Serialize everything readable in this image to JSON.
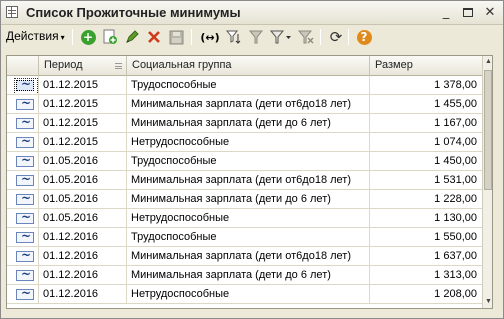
{
  "window": {
    "title": "Список Прожиточные минимумы",
    "btn_min": "_",
    "btn_close": "✕"
  },
  "toolbar": {
    "actions_label": "Действия",
    "actions_caret": "▾",
    "icons": [
      "add-icon",
      "copy-icon",
      "edit-icon",
      "delete-icon",
      "save-icon",
      "move-icon",
      "filter-icon",
      "filter-set-icon",
      "filter-dropdown-icon",
      "filter-clear-icon",
      "refresh-icon",
      "help-icon"
    ]
  },
  "table": {
    "columns": [
      "",
      "Период",
      "Социальная группа",
      "Размер"
    ],
    "rows": [
      {
        "period": "01.12.2015",
        "group": "Трудоспособные",
        "amount": "1 378,00"
      },
      {
        "period": "01.12.2015",
        "group": "Минимальная зарплата (дети от6до18 лет)",
        "amount": "1 455,00"
      },
      {
        "period": "01.12.2015",
        "group": "Минимальная зарплата (дети до 6 лет)",
        "amount": "1 167,00"
      },
      {
        "period": "01.12.2015",
        "group": "Нетрудоспособные",
        "amount": "1 074,00"
      },
      {
        "period": "01.05.2016",
        "group": "Трудоспособные",
        "amount": "1 450,00"
      },
      {
        "period": "01.05.2016",
        "group": "Минимальная зарплата (дети от6до18 лет)",
        "amount": "1 531,00"
      },
      {
        "period": "01.05.2016",
        "group": "Минимальная зарплата (дети до 6 лет)",
        "amount": "1 228,00"
      },
      {
        "period": "01.05.2016",
        "group": "Нетрудоспособные",
        "amount": "1 130,00"
      },
      {
        "period": "01.12.2016",
        "group": "Трудоспособные",
        "amount": "1 550,00"
      },
      {
        "period": "01.12.2016",
        "group": "Минимальная зарплата (дети от6до18 лет)",
        "amount": "1 637,00"
      },
      {
        "period": "01.12.2016",
        "group": "Минимальная зарплата (дети до 6 лет)",
        "amount": "1 313,00"
      },
      {
        "period": "01.12.2016",
        "group": "Нетрудоспособные",
        "amount": "1 208,00"
      }
    ]
  },
  "colors": {
    "accent_green": "#3aa12f",
    "delete_red": "#d03a1c",
    "help_orange": "#e08a1c",
    "grid_border": "#9b9786"
  }
}
